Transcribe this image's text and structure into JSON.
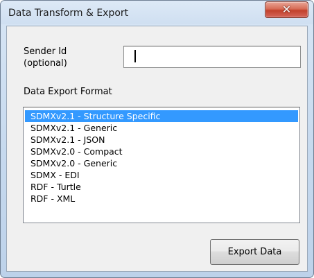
{
  "window": {
    "title": "Data Transform & Export",
    "close_icon": "close-x-icon"
  },
  "sender": {
    "label_line1": "Sender Id",
    "label_line2": "(optional)",
    "value": "",
    "placeholder": ""
  },
  "export_format": {
    "label": "Data Export Format",
    "options": [
      "SDMXv2.1 - Structure Specific",
      "SDMXv2.1 - Generic",
      "SDMXv2.1 - JSON",
      "SDMXv2.0 - Compact",
      "SDMXv2.0 - Generic",
      "SDMX - EDI",
      "RDF - Turtle",
      "RDF - XML"
    ],
    "selected": "SDMXv2.1 - Structure Specific"
  },
  "buttons": {
    "export_label": "Export Data"
  },
  "colors": {
    "selection": "#3399ff",
    "close_button": "#c2412b"
  }
}
